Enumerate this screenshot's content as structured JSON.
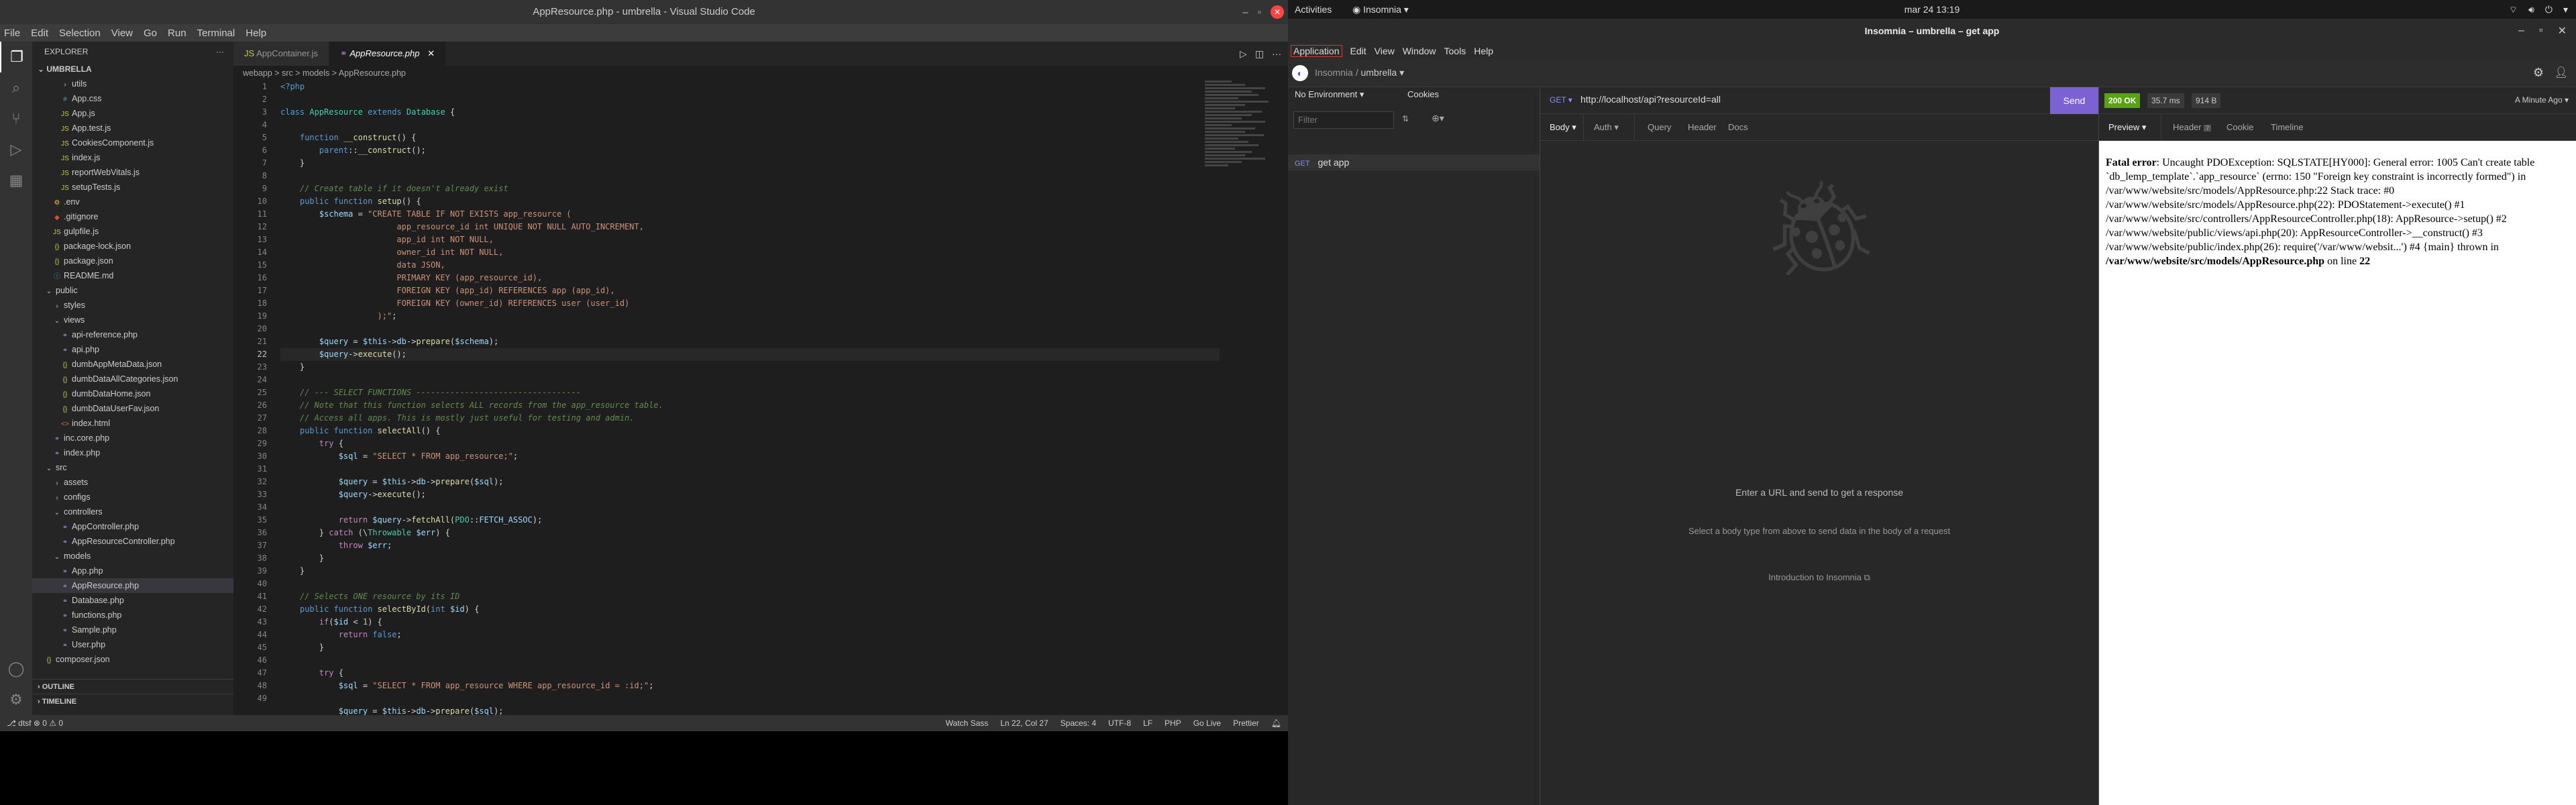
{
  "vscode": {
    "title": "AppResource.php - umbrella - Visual Studio Code",
    "menu": [
      "File",
      "Edit",
      "Selection",
      "View",
      "Go",
      "Run",
      "Terminal",
      "Help"
    ],
    "explorer_label": "EXPLORER",
    "project": "UMBRELLA",
    "tree": [
      {
        "t": "utils",
        "d": 2,
        "k": "folder",
        "c": ">"
      },
      {
        "t": "App.css",
        "d": 2,
        "k": "css"
      },
      {
        "t": "App.js",
        "d": 2,
        "k": "js"
      },
      {
        "t": "App.test.js",
        "d": 2,
        "k": "js"
      },
      {
        "t": "CookiesComponent.js",
        "d": 2,
        "k": "js"
      },
      {
        "t": "index.js",
        "d": 2,
        "k": "js"
      },
      {
        "t": "reportWebVitals.js",
        "d": 2,
        "k": "js"
      },
      {
        "t": "setupTests.js",
        "d": 2,
        "k": "js"
      },
      {
        "t": ".env",
        "d": 1,
        "k": "env"
      },
      {
        "t": ".gitignore",
        "d": 1,
        "k": "git"
      },
      {
        "t": "gulpfile.js",
        "d": 1,
        "k": "js"
      },
      {
        "t": "package-lock.json",
        "d": 1,
        "k": "json"
      },
      {
        "t": "package.json",
        "d": 1,
        "k": "json"
      },
      {
        "t": "README.md",
        "d": 1,
        "k": "md"
      },
      {
        "t": "public",
        "d": 0,
        "k": "folder",
        "c": "v"
      },
      {
        "t": "styles",
        "d": 1,
        "k": "folder",
        "c": ">"
      },
      {
        "t": "views",
        "d": 1,
        "k": "folder",
        "c": "v"
      },
      {
        "t": "api-reference.php",
        "d": 2,
        "k": "php"
      },
      {
        "t": "api.php",
        "d": 2,
        "k": "php"
      },
      {
        "t": "dumbAppMetaData.json",
        "d": 2,
        "k": "json"
      },
      {
        "t": "dumbDataAllCategories.json",
        "d": 2,
        "k": "json"
      },
      {
        "t": "dumbDataHome.json",
        "d": 2,
        "k": "json"
      },
      {
        "t": "dumbDataUserFav.json",
        "d": 2,
        "k": "json"
      },
      {
        "t": "index.html",
        "d": 2,
        "k": "html"
      },
      {
        "t": "inc.core.php",
        "d": 1,
        "k": "php"
      },
      {
        "t": "index.php",
        "d": 1,
        "k": "php"
      },
      {
        "t": "src",
        "d": 0,
        "k": "folder",
        "c": "v"
      },
      {
        "t": "assets",
        "d": 1,
        "k": "folder",
        "c": ">"
      },
      {
        "t": "configs",
        "d": 1,
        "k": "folder",
        "c": ">"
      },
      {
        "t": "controllers",
        "d": 1,
        "k": "folder",
        "c": "v"
      },
      {
        "t": "AppController.php",
        "d": 2,
        "k": "php"
      },
      {
        "t": "AppResourceController.php",
        "d": 2,
        "k": "php"
      },
      {
        "t": "models",
        "d": 1,
        "k": "folder",
        "c": "v"
      },
      {
        "t": "App.php",
        "d": 2,
        "k": "php"
      },
      {
        "t": "AppResource.php",
        "d": 2,
        "k": "php",
        "sel": true
      },
      {
        "t": "Database.php",
        "d": 2,
        "k": "php"
      },
      {
        "t": "functions.php",
        "d": 2,
        "k": "php"
      },
      {
        "t": "Sample.php",
        "d": 2,
        "k": "php"
      },
      {
        "t": "User.php",
        "d": 2,
        "k": "php"
      },
      {
        "t": "composer.json",
        "d": 0,
        "k": "json"
      }
    ],
    "outline_label": "OUTLINE",
    "timeline_label": "TIMELINE",
    "tabs": [
      "AppContainer.js",
      "AppResource.php"
    ],
    "breadcrumb": "webapp > src > models > AppResource.php",
    "status_left": "⎇ dtsf   ⊗ 0 ⚠ 0",
    "status_right": [
      "Watch Sass",
      "Ln 22, Col 27",
      "Spaces: 4",
      "UTF-8",
      "LF",
      "PHP",
      "Go Live",
      "Prettier"
    ]
  },
  "insomnia": {
    "topbar": {
      "activities": "Activities",
      "app": "Insomnia",
      "clock": "mar 24  13:19"
    },
    "title": "Insomnia – umbrella – get app",
    "menu": [
      "Application",
      "Edit",
      "View",
      "Window",
      "Tools",
      "Help"
    ],
    "breadcrumb_root": "Insomnia",
    "breadcrumb_project": "umbrella",
    "environment": "No Environment",
    "cookies": "Cookies",
    "filter_placeholder": "Filter",
    "request": {
      "method": "GET",
      "name": "get app"
    },
    "url": "http://localhost/api?resourceId=all",
    "send": "Send",
    "req_tabs": [
      "Body",
      "Auth",
      "Query",
      "Header",
      "Docs"
    ],
    "empty_title": "Enter a URL and send to get a response",
    "empty_hint": "Select a body type from above to send data in the body of a request",
    "intro_link": "Introduction to Insomnia",
    "status": "200 OK",
    "time": "35.7 ms",
    "size": "914 B",
    "ago": "A Minute Ago",
    "resp_tabs": [
      "Preview",
      "Header",
      "Cookie",
      "Timeline"
    ],
    "header_count": "7",
    "error_label": "Fatal error",
    "error_body": ": Uncaught PDOException: SQLSTATE[HY000]: General error: 1005 Can't create table `db_lemp_template`.`app_resource` (errno: 150 \"Foreign key constraint is incorrectly formed\") in /var/www/website/src/models/AppResource.php:22 Stack trace: #0 /var/www/website/src/models/AppResource.php(22): PDOStatement->execute() #1 /var/www/website/src/controllers/AppResourceController.php(18): AppResource->setup() #2 /var/www/website/public/views/api.php(20): AppResourceController->__construct() #3 /var/www/website/public/index.php(26): require('/var/www/websit...') #4 {main} thrown in ",
    "error_file": "/var/www/website/src/models/AppResource.php",
    "error_on": " on line ",
    "error_line": "22"
  }
}
